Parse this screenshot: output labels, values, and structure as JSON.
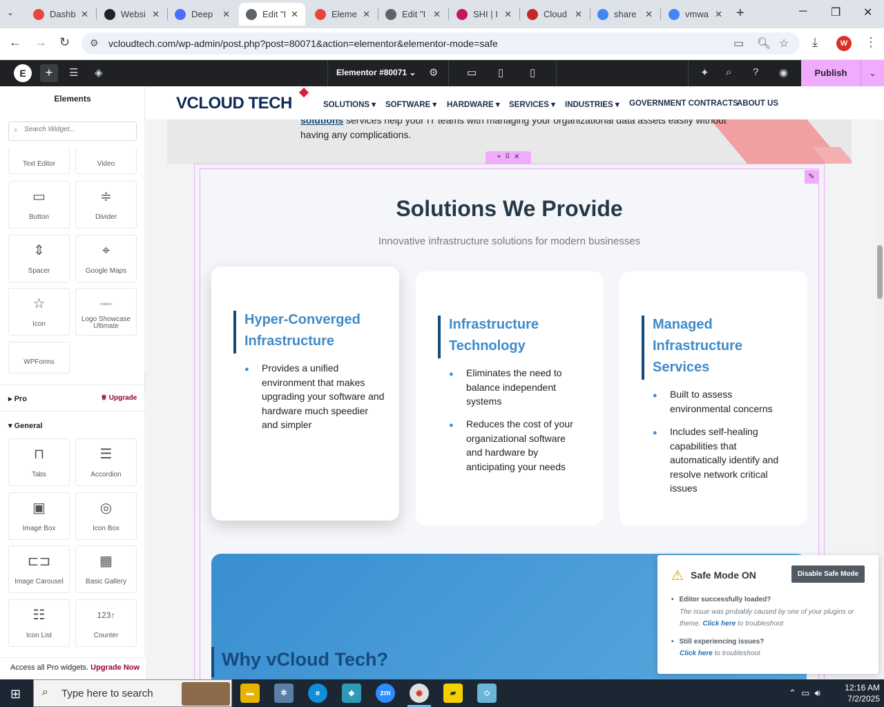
{
  "browser": {
    "tabs": [
      {
        "title": "Dashb",
        "color": "#e8453c"
      },
      {
        "title": "Websi",
        "color": "#222222"
      },
      {
        "title": "Deep",
        "color": "#4d6bfe"
      },
      {
        "title": "Edit \"I",
        "color": "#5f6368"
      },
      {
        "title": "Eleme",
        "color": "#e8453c"
      },
      {
        "title": "Edit \"I",
        "color": "#5f6368"
      },
      {
        "title": "SHI | I",
        "color": "#c2185b"
      },
      {
        "title": "Cloud",
        "color": "#c62828"
      },
      {
        "title": "share",
        "color": "#4285f4"
      },
      {
        "title": "vmwa",
        "color": "#4285f4"
      }
    ],
    "url": "vcloudtech.com/wp-admin/post.php?post=80071&action=elementor&elementor-mode=safe",
    "profile_initial": "W"
  },
  "editor_bar": {
    "document_title": "Elementor #80071",
    "publish_label": "Publish"
  },
  "panel": {
    "title": "Elements",
    "search_placeholder": "Search Widget...",
    "widgets_top": [
      {
        "label": "Text Editor",
        "icon": "text-editor-icon"
      },
      {
        "label": "Video",
        "icon": "video-icon"
      },
      {
        "label": "Button",
        "icon": "button-icon"
      },
      {
        "label": "Divider",
        "icon": "divider-icon"
      },
      {
        "label": "Spacer",
        "icon": "spacer-icon"
      },
      {
        "label": "Google Maps",
        "icon": "map-icon"
      },
      {
        "label": "Icon",
        "icon": "star-icon"
      },
      {
        "label": "Logo Showcase Ultimate",
        "icon": "logo-showcase-icon"
      },
      {
        "label": "WPForms",
        "icon": ""
      }
    ],
    "pro_label": "Pro",
    "upgrade_label": "Upgrade",
    "general_label": "General",
    "widgets_general": [
      {
        "label": "Tabs",
        "icon": "tabs-icon"
      },
      {
        "label": "Accordion",
        "icon": "accordion-icon"
      },
      {
        "label": "Image Box",
        "icon": "image-box-icon"
      },
      {
        "label": "Icon Box",
        "icon": "icon-box-icon"
      },
      {
        "label": "Image Carousel",
        "icon": "carousel-icon"
      },
      {
        "label": "Basic Gallery",
        "icon": "gallery-icon"
      },
      {
        "label": "Icon List",
        "icon": "list-icon"
      },
      {
        "label": "Counter",
        "icon": "counter-icon"
      }
    ],
    "footer_text": "Access all Pro widgets.",
    "footer_link": "Upgrade Now"
  },
  "site": {
    "logo_main": "VCLOUD",
    "logo_accent": "TECH",
    "menu": [
      "SOLUTIONS",
      "SOFTWARE",
      "HARDWARE",
      "SERVICES",
      "INDUSTRIES",
      "GOVERNMENT CONTRACTS",
      "ABOUT US"
    ],
    "hero_link": "solutions",
    "hero_text": " services help your IT teams with managing your organizational data assets easily without having any complications.",
    "section_title": "Solutions We Provide",
    "section_subtitle": "Innovative infrastructure solutions for modern businesses",
    "cards": [
      {
        "title": "Hyper-Converged Infrastructure",
        "points": [
          "Provides a unified environment that makes upgrading your software and hardware much speedier and simpler"
        ]
      },
      {
        "title": "Infrastructure Technology",
        "points": [
          "Eliminates the need to balance independent systems",
          "Reduces the cost of your organizational software and hardware by anticipating your needs"
        ]
      },
      {
        "title": "Managed Infrastructure Services",
        "points": [
          "Built to assess environmental concerns",
          "Includes self-healing capabilities that automatically identify and resolve network critical issues"
        ]
      }
    ],
    "why_title": "Why vCloud Tech?"
  },
  "safe_mode": {
    "title": "Safe Mode ON",
    "button": "Disable Safe Mode",
    "item1": "Editor successfully loaded?",
    "item1_desc": "The issue was probably caused by one of your plugins or theme.",
    "item1_link": "Click here",
    "item1_tail": "to troubleshoot",
    "item2": "Still experiencing issues?",
    "item2_link": "Click here",
    "item2_tail": "to troubleshoot"
  },
  "taskbar": {
    "search_placeholder": "Type here to search",
    "time": "12:16 AM",
    "date": "7/2/2025"
  }
}
